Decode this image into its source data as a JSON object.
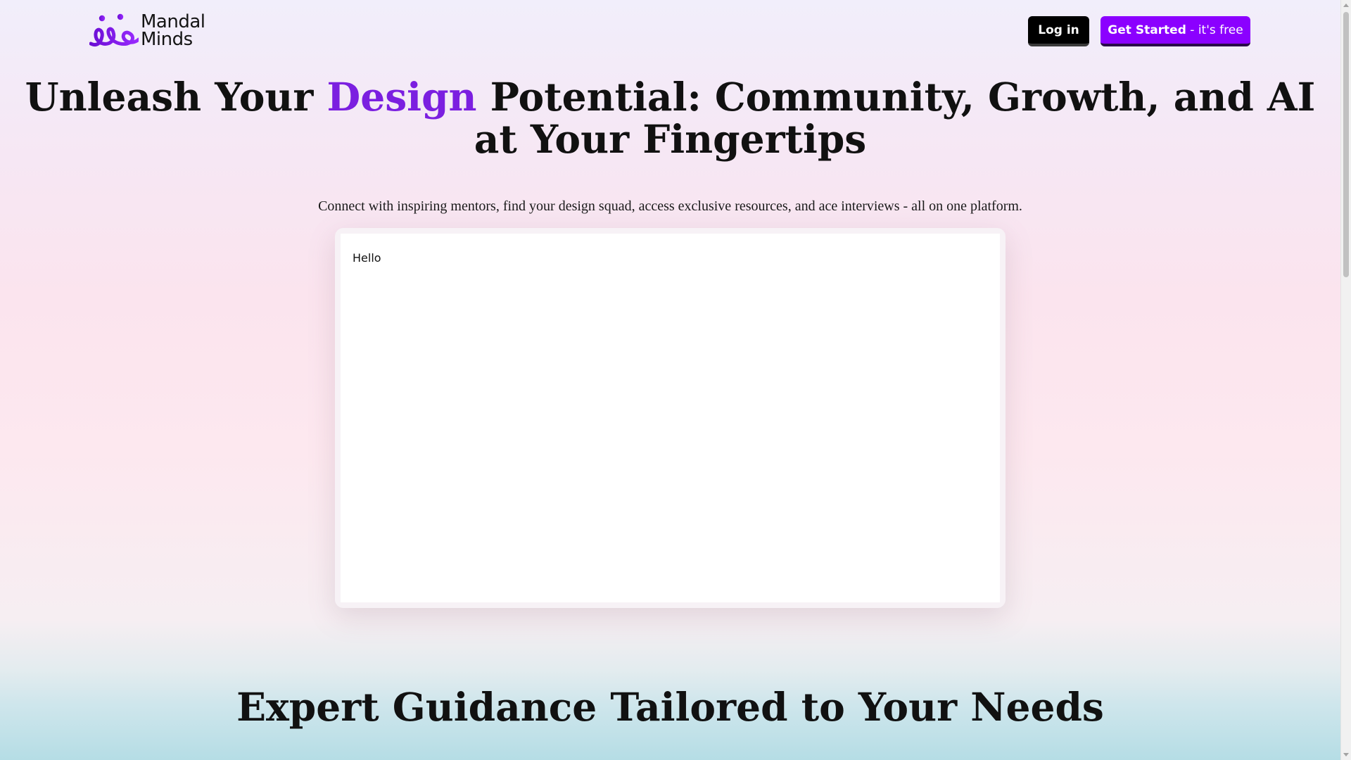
{
  "header": {
    "logo_line1": "Mandal",
    "logo_line2": "Minds",
    "login_label": "Log in",
    "get_started_label": "Get Started",
    "get_started_suffix": " - it's free"
  },
  "hero": {
    "title_part1": "Unleash Your ",
    "title_accent": "Design",
    "title_part2": " Potential: Community, Growth, and AI at Your Fingertips",
    "subtitle": "Connect with inspiring mentors, find your design squad, access exclusive resources, and ace interviews - all on one platform."
  },
  "card": {
    "content": "Hello"
  },
  "section": {
    "title": "Expert Guidance Tailored to Your Needs"
  },
  "colors": {
    "accent": "#7b1fe0",
    "primary_button": "#8b00ff",
    "login_button": "#000000"
  },
  "icons": {
    "logo": "mandal-minds-logo-icon"
  }
}
